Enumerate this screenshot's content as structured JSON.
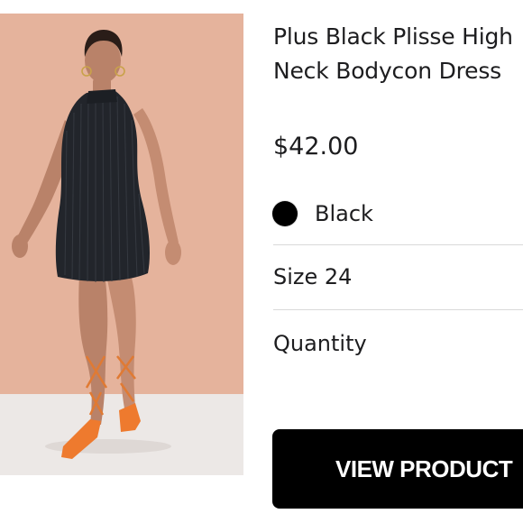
{
  "product": {
    "title": "Plus Black Plisse High Neck Bodycon Dress",
    "price": "$42.00",
    "color": {
      "name": "Black",
      "swatch": "#000000"
    },
    "size_label": "Size 24",
    "quantity_label": "Quantity",
    "image": {
      "type": "product-photo",
      "background_color": "#e9b9a2",
      "floor_color": "#ece8e6"
    }
  },
  "actions": {
    "view_product_label": "VIEW PRODUCT"
  }
}
